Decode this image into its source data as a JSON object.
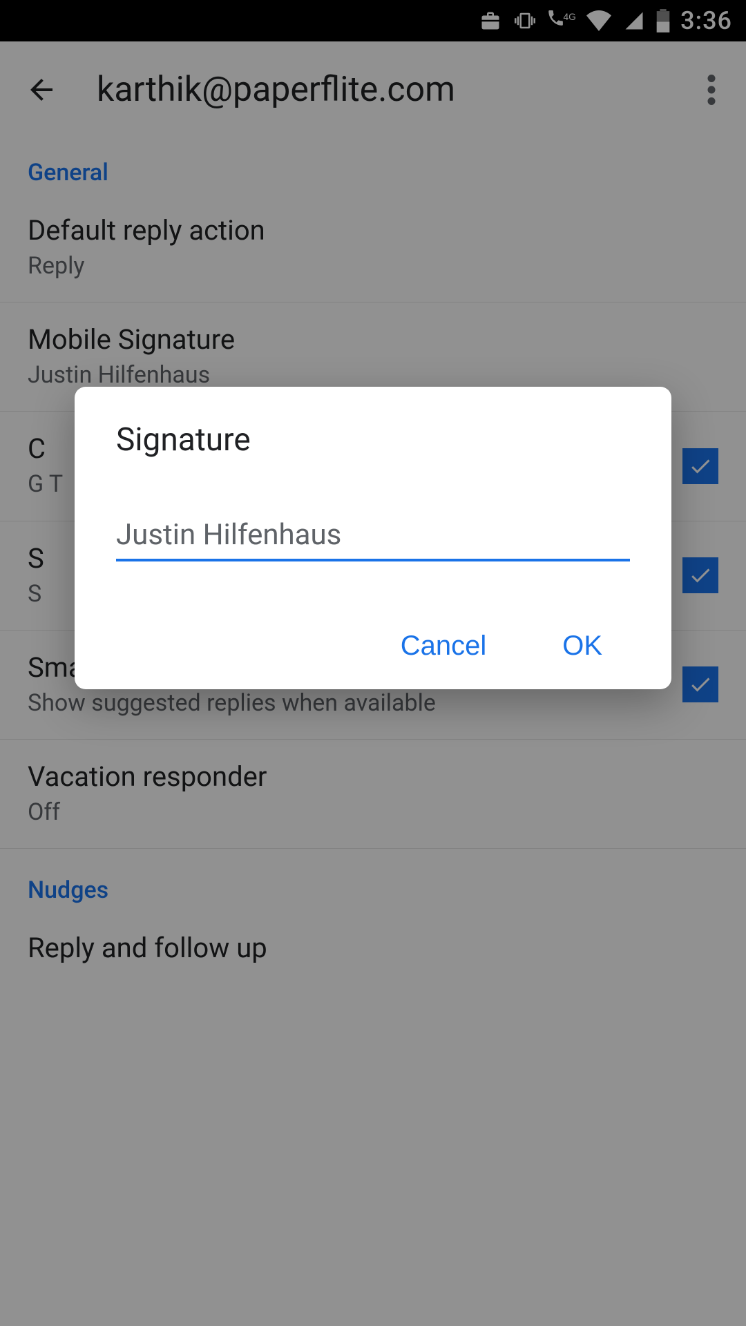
{
  "statusBar": {
    "time": "3:36"
  },
  "header": {
    "title": "karthik@paperflite.com"
  },
  "sections": {
    "general": {
      "label": "General"
    },
    "nudges": {
      "label": "Nudges"
    }
  },
  "items": {
    "defaultReply": {
      "title": "Default reply action",
      "sub": "Reply"
    },
    "mobileSignature": {
      "title": "Mobile Signature",
      "sub": "Justin Hilfenhaus"
    },
    "conversationView": {
      "title": "C",
      "sub": "G\nT"
    },
    "smartCompose": {
      "title": "S",
      "sub": "S"
    },
    "smartReply": {
      "title": "Smart Reply",
      "sub": "Show suggested replies when available"
    },
    "vacation": {
      "title": "Vacation responder",
      "sub": "Off"
    },
    "replyFollow": {
      "title": "Reply and follow up"
    }
  },
  "dialog": {
    "title": "Signature",
    "value": "Justin Hilfenhaus",
    "cancel": "Cancel",
    "ok": "OK"
  }
}
